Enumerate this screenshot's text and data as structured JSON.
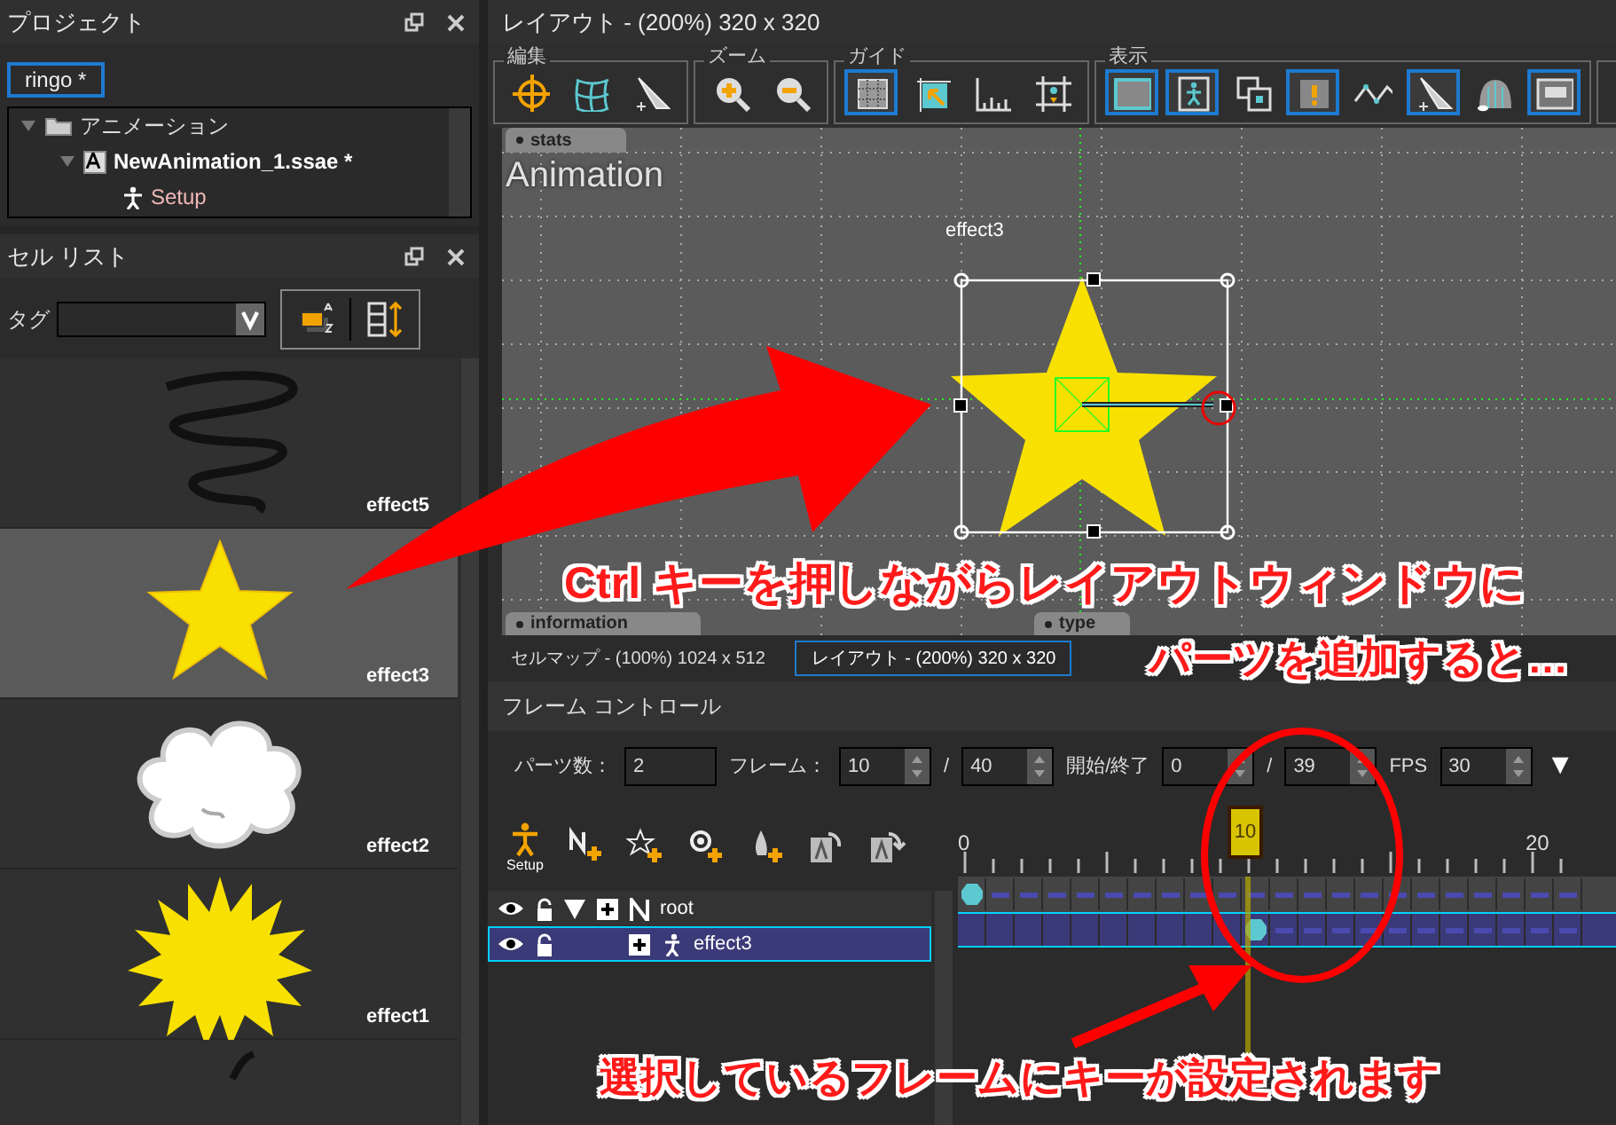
{
  "project_panel": {
    "title": "プロジェクト",
    "project_name": "ringo *",
    "tree": [
      {
        "label": "アニメーション",
        "kind": "folder",
        "expanded": true,
        "children": [
          {
            "label": "NewAnimation_1.ssae *",
            "kind": "animation",
            "expanded": true,
            "children": [
              {
                "label": "Setup",
                "kind": "setup"
              }
            ]
          }
        ]
      }
    ]
  },
  "cell_list_panel": {
    "title": "セル リスト",
    "tag_label": "タグ",
    "cells": [
      {
        "label": "effect5",
        "kind": "scribble",
        "selected": false
      },
      {
        "label": "effect3",
        "kind": "star",
        "selected": true
      },
      {
        "label": "effect2",
        "kind": "cloud",
        "selected": false
      },
      {
        "label": "effect1",
        "kind": "burst",
        "selected": false
      },
      {
        "kind": "stroke",
        "selected": false
      }
    ]
  },
  "layout_window": {
    "title": "レイアウト - (200%) 320 x 320",
    "toolbar_groups": [
      {
        "label": "編集",
        "buttons": [
          {
            "kind": "move",
            "active": false
          },
          {
            "kind": "mesh",
            "active": false
          },
          {
            "kind": "arrow",
            "active": false
          }
        ]
      },
      {
        "label": "ズーム",
        "buttons": [
          {
            "kind": "zoom-in",
            "active": false
          },
          {
            "kind": "zoom-out",
            "active": false
          }
        ]
      },
      {
        "label": "ガイド",
        "buttons": [
          {
            "kind": "grid",
            "active": true
          },
          {
            "kind": "origin",
            "active": false
          },
          {
            "kind": "ruler",
            "active": false
          },
          {
            "kind": "frame",
            "active": false
          }
        ]
      },
      {
        "label": "表示",
        "buttons": [
          {
            "kind": "screen",
            "active": true
          },
          {
            "kind": "figure",
            "active": true
          },
          {
            "kind": "layers",
            "active": false
          },
          {
            "kind": "alert",
            "active": true
          },
          {
            "kind": "wave",
            "active": false
          },
          {
            "kind": "arrow",
            "active": true
          },
          {
            "kind": "dome",
            "active": false
          },
          {
            "kind": "monitor",
            "active": true
          }
        ]
      }
    ],
    "stats_tab": "stats",
    "canvas_title": "Animation",
    "part_label": "effect3",
    "info_tab": "information",
    "type_tab": "type"
  },
  "view_tabs": [
    {
      "label": "セルマップ - (100%) 1024 x 512",
      "selected": false
    },
    {
      "label": "レイアウト - (200%) 320 x 320",
      "selected": true
    }
  ],
  "frame_control": {
    "title": "フレーム コントロール",
    "fields": [
      {
        "label": "パーツ数：",
        "value": "2",
        "kind": "plain"
      },
      {
        "label": "フレーム：",
        "value": "10",
        "kind": "spin"
      },
      {
        "label": "/",
        "value": "40",
        "kind": "spin"
      },
      {
        "label": "開始/終了",
        "value": "0",
        "kind": "spin"
      },
      {
        "label": "/",
        "value": "39",
        "kind": "spin"
      },
      {
        "label": "FPS",
        "value": "30",
        "kind": "spin"
      }
    ],
    "menu_glyph": "▼",
    "setup_label": "Setup",
    "tools": [
      {
        "kind": "setup"
      },
      {
        "kind": "null-add"
      },
      {
        "kind": "star-add"
      },
      {
        "kind": "circle-add"
      },
      {
        "kind": "drop-add"
      },
      {
        "kind": "a-rotate"
      },
      {
        "kind": "a-flip"
      }
    ],
    "ruler_labels": [
      "0",
      "20"
    ],
    "current_frame": "10",
    "tracks": [
      {
        "name": "root",
        "kind": "null",
        "selected": false,
        "expanded": true,
        "keys": [
          true,
          false,
          false,
          false,
          false,
          false,
          false,
          false,
          false,
          false,
          false,
          false,
          false,
          false,
          false,
          false,
          false,
          false,
          false,
          false,
          false,
          false
        ]
      },
      {
        "name": "effect3",
        "kind": "part",
        "selected": true,
        "expanded": false,
        "keys": [
          false,
          false,
          false,
          false,
          false,
          false,
          false,
          false,
          false,
          false,
          true,
          false,
          false,
          false,
          false,
          false,
          false,
          false,
          false,
          false,
          false,
          false
        ]
      }
    ]
  },
  "annotations": [
    {
      "text": "Ctrl キーを押しながらレイアウトウィンドウに"
    },
    {
      "text": "パーツを追加すると…"
    },
    {
      "text": "選択しているフレームにキーが設定されます"
    }
  ]
}
